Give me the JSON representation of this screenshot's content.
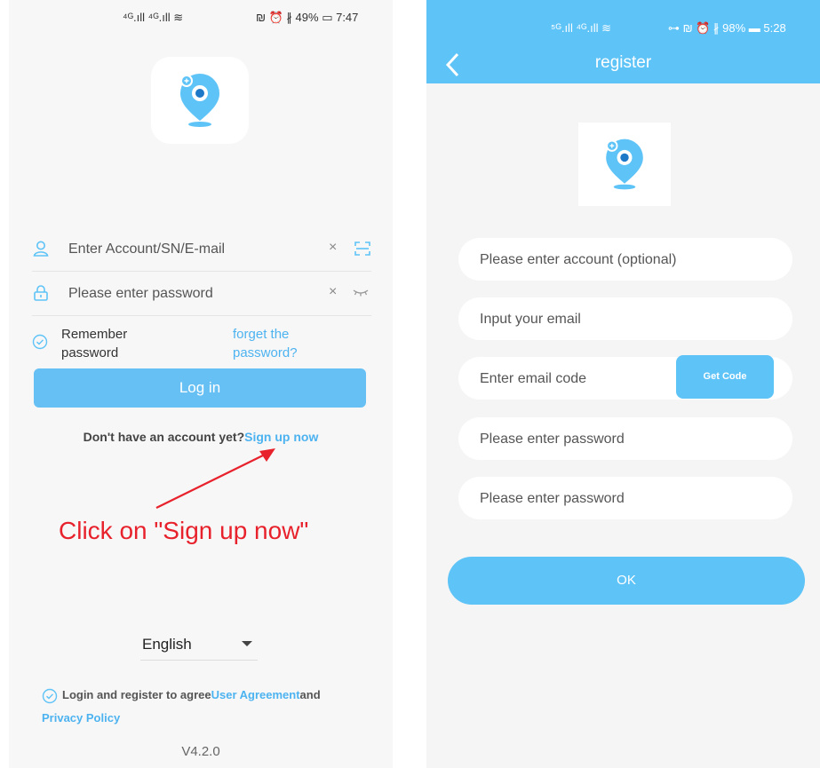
{
  "left": {
    "status_signal": "⁴ᴳ.ıll ⁴ᴳ.ıll ≋",
    "status_right": "₪ ⏰ ∦ 49% ▭ 7:47",
    "account_placeholder": "Enter Account/SN/E-mail",
    "password_placeholder": "Please enter password",
    "clear_glyph": "×",
    "remember_label": "Remember password",
    "forget_label": "forget the password?",
    "login_label": "Log in",
    "signup_prompt": "Don't have an account yet?",
    "signup_link": "Sign up now",
    "annotation": "Click on \"Sign up now\"",
    "language": "English",
    "agree_text": "Login and register to agree",
    "user_agreement": "User Agreement",
    "and_text": "and",
    "privacy_policy": "Privacy Policy",
    "version": "V4.2.0"
  },
  "right": {
    "status_signal": "⁵ᴳ.ıll ⁴ᴳ.ıll ≋",
    "status_right": "⊶ ₪ ⏰ ∦ 98% ▬ 5:28",
    "title": "register",
    "account_placeholder": "Please enter account (optional)",
    "email_placeholder": "Input your email",
    "code_placeholder": "Enter email code",
    "get_code_label": "Get Code",
    "password_placeholder": "Please enter password",
    "confirm_password_placeholder": "Please enter password",
    "ok_label": "OK"
  },
  "colors": {
    "accent": "#5ec3f7",
    "link": "#4db3f0",
    "annotation": "#e8222c"
  }
}
